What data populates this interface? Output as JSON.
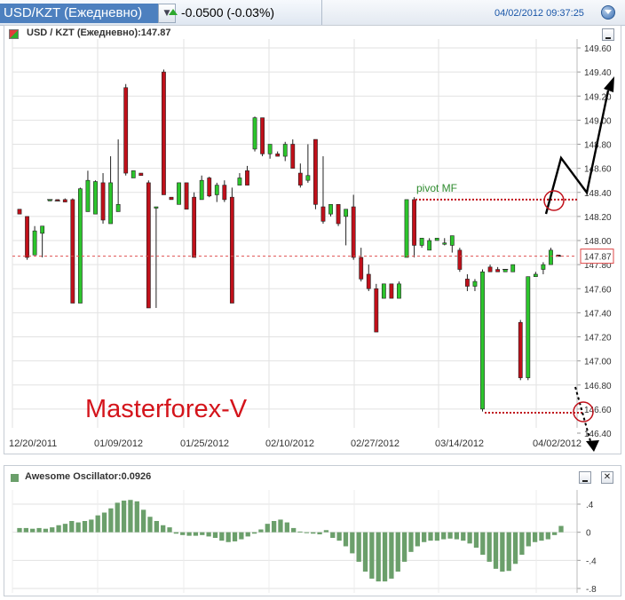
{
  "header": {
    "title": "USD/KZT (Ежедневно)",
    "change": "-0.0500 (-0.03%)",
    "datetime": "04/02/2012 09:37:25",
    "change_color": "#2da82d",
    "accent": "#4d80bf"
  },
  "main_panel": {
    "label": "USD / KZT (Ежедневно):147.87",
    "minimize_icon": "minimize-icon",
    "watermark": "Masterforex-V",
    "pivot_label": "pivot MF",
    "current_price_label": "147.87"
  },
  "osc_panel": {
    "label": "Awesome Oscillator:0.0926",
    "minimize_icon": "minimize-icon",
    "close_icon": "close-icon",
    "close_glyph": "✕"
  },
  "chart_data": [
    {
      "type": "candlestick",
      "title": "USD / KZT (Ежедневно):147.87",
      "y_ticks": [
        "149.60",
        "149.40",
        "149.20",
        "149.00",
        "148.80",
        "148.60",
        "148.40",
        "148.20",
        "148.00",
        "147.80",
        "147.60",
        "147.40",
        "147.20",
        "147.00",
        "146.80",
        "146.60",
        "146.40"
      ],
      "x_ticks": [
        "12/20/2011",
        "01/09/2012",
        "01/25/2012",
        "02/10/2012",
        "02/27/2012",
        "03/14/2012",
        "04/02/2012"
      ],
      "ylim": [
        146.33,
        149.7
      ],
      "current_price": 147.87,
      "pivot_level": 148.34,
      "support_level": 146.57,
      "pivot_label": "pivot MF",
      "up_color": "#2cc52c",
      "down_color": "#c0101a",
      "candles": [
        {
          "o": 148.26,
          "h": 148.26,
          "l": 148.22,
          "c": 148.22
        },
        {
          "o": 148.2,
          "h": 148.2,
          "l": 147.84,
          "c": 147.86
        },
        {
          "o": 147.88,
          "h": 148.12,
          "l": 147.88,
          "c": 148.08
        },
        {
          "o": 148.06,
          "h": 148.1,
          "l": 147.86,
          "c": 148.12
        },
        {
          "o": 148.34,
          "h": 148.34,
          "l": 148.34,
          "c": 148.34
        },
        {
          "o": 148.34,
          "h": 148.34,
          "l": 148.33,
          "c": 148.33
        },
        {
          "o": 148.34,
          "h": 148.35,
          "l": 148.32,
          "c": 148.32
        },
        {
          "o": 148.34,
          "h": 148.35,
          "l": 147.48,
          "c": 147.48
        },
        {
          "o": 147.48,
          "h": 148.44,
          "l": 147.48,
          "c": 148.43
        },
        {
          "o": 148.24,
          "h": 148.58,
          "l": 148.24,
          "c": 148.5
        },
        {
          "o": 148.22,
          "h": 148.5,
          "l": 148.22,
          "c": 148.49
        },
        {
          "o": 148.48,
          "h": 148.56,
          "l": 148.14,
          "c": 148.17
        },
        {
          "o": 148.14,
          "h": 148.7,
          "l": 148.14,
          "c": 148.48
        },
        {
          "o": 148.24,
          "h": 148.84,
          "l": 148.24,
          "c": 148.3
        },
        {
          "o": 149.27,
          "h": 149.3,
          "l": 148.54,
          "c": 148.56
        },
        {
          "o": 148.52,
          "h": 148.58,
          "l": 148.52,
          "c": 148.58
        },
        {
          "o": 148.56,
          "h": 148.56,
          "l": 148.54,
          "c": 148.54
        },
        {
          "o": 148.48,
          "h": 148.5,
          "l": 147.44,
          "c": 147.44
        },
        {
          "o": 148.28,
          "h": 148.28,
          "l": 147.44,
          "c": 148.28
        },
        {
          "o": 149.4,
          "h": 149.42,
          "l": 148.38,
          "c": 148.38
        },
        {
          "o": 148.36,
          "h": 148.36,
          "l": 148.34,
          "c": 148.34
        },
        {
          "o": 148.3,
          "h": 148.48,
          "l": 148.3,
          "c": 148.48
        },
        {
          "o": 148.48,
          "h": 148.48,
          "l": 148.26,
          "c": 148.26
        },
        {
          "o": 148.36,
          "h": 148.4,
          "l": 147.86,
          "c": 147.86
        },
        {
          "o": 148.34,
          "h": 148.54,
          "l": 148.34,
          "c": 148.5
        },
        {
          "o": 148.52,
          "h": 148.53,
          "l": 148.36,
          "c": 148.37
        },
        {
          "o": 148.38,
          "h": 148.48,
          "l": 148.32,
          "c": 148.46
        },
        {
          "o": 148.46,
          "h": 148.5,
          "l": 148.32,
          "c": 148.34
        },
        {
          "o": 148.36,
          "h": 148.44,
          "l": 147.48,
          "c": 147.48
        },
        {
          "o": 148.46,
          "h": 148.56,
          "l": 148.46,
          "c": 148.52
        },
        {
          "o": 148.58,
          "h": 148.62,
          "l": 148.46,
          "c": 148.46
        },
        {
          "o": 148.76,
          "h": 149.03,
          "l": 148.74,
          "c": 149.02
        },
        {
          "o": 149.02,
          "h": 149.02,
          "l": 148.7,
          "c": 148.72
        },
        {
          "o": 148.72,
          "h": 148.8,
          "l": 148.68,
          "c": 148.8
        },
        {
          "o": 148.72,
          "h": 148.74,
          "l": 148.7,
          "c": 148.7
        },
        {
          "o": 148.7,
          "h": 148.82,
          "l": 148.66,
          "c": 148.8
        },
        {
          "o": 148.8,
          "h": 148.84,
          "l": 148.6,
          "c": 148.6
        },
        {
          "o": 148.56,
          "h": 148.64,
          "l": 148.44,
          "c": 148.46
        },
        {
          "o": 148.5,
          "h": 148.8,
          "l": 148.48,
          "c": 148.54
        },
        {
          "o": 148.84,
          "h": 148.84,
          "l": 148.26,
          "c": 148.3
        },
        {
          "o": 148.28,
          "h": 148.7,
          "l": 148.14,
          "c": 148.16
        },
        {
          "o": 148.22,
          "h": 148.3,
          "l": 148.2,
          "c": 148.3
        },
        {
          "o": 148.3,
          "h": 148.3,
          "l": 148.12,
          "c": 148.14
        },
        {
          "o": 148.2,
          "h": 148.26,
          "l": 147.96,
          "c": 148.26
        },
        {
          "o": 148.28,
          "h": 148.38,
          "l": 147.84,
          "c": 147.86
        },
        {
          "o": 147.86,
          "h": 147.94,
          "l": 147.66,
          "c": 147.68
        },
        {
          "o": 147.72,
          "h": 147.8,
          "l": 147.58,
          "c": 147.6
        },
        {
          "o": 147.6,
          "h": 147.64,
          "l": 147.24,
          "c": 147.24
        },
        {
          "o": 147.52,
          "h": 147.64,
          "l": 147.52,
          "c": 147.64
        },
        {
          "o": 147.64,
          "h": 147.64,
          "l": 147.52,
          "c": 147.52
        },
        {
          "o": 147.52,
          "h": 147.66,
          "l": 147.52,
          "c": 147.64
        },
        {
          "o": 147.86,
          "h": 148.34,
          "l": 147.86,
          "c": 148.34
        },
        {
          "o": 148.34,
          "h": 148.36,
          "l": 147.86,
          "c": 147.96
        },
        {
          "o": 147.96,
          "h": 148.02,
          "l": 147.94,
          "c": 148.02
        },
        {
          "o": 147.92,
          "h": 148.02,
          "l": 147.92,
          "c": 148.0
        },
        {
          "o": 148.0,
          "h": 148.02,
          "l": 148.0,
          "c": 148.02
        },
        {
          "o": 147.98,
          "h": 148.02,
          "l": 147.96,
          "c": 147.98
        },
        {
          "o": 147.96,
          "h": 148.04,
          "l": 147.9,
          "c": 148.04
        },
        {
          "o": 147.92,
          "h": 147.94,
          "l": 147.74,
          "c": 147.76
        },
        {
          "o": 147.68,
          "h": 147.72,
          "l": 147.58,
          "c": 147.62
        },
        {
          "o": 147.62,
          "h": 147.68,
          "l": 147.58,
          "c": 147.66
        },
        {
          "o": 146.6,
          "h": 147.76,
          "l": 146.58,
          "c": 147.74
        },
        {
          "o": 147.78,
          "h": 147.8,
          "l": 147.74,
          "c": 147.74
        },
        {
          "o": 147.76,
          "h": 147.78,
          "l": 147.74,
          "c": 147.74
        },
        {
          "o": 147.74,
          "h": 147.76,
          "l": 147.74,
          "c": 147.76
        },
        {
          "o": 147.74,
          "h": 147.8,
          "l": 147.74,
          "c": 147.8
        },
        {
          "o": 147.32,
          "h": 147.34,
          "l": 146.84,
          "c": 146.86
        },
        {
          "o": 146.86,
          "h": 147.7,
          "l": 146.84,
          "c": 147.7
        },
        {
          "o": 147.7,
          "h": 147.74,
          "l": 147.7,
          "c": 147.72
        },
        {
          "o": 147.76,
          "h": 147.82,
          "l": 147.72,
          "c": 147.8
        },
        {
          "o": 147.8,
          "h": 147.94,
          "l": 147.8,
          "c": 147.92
        },
        {
          "o": 147.88,
          "h": 147.88,
          "l": 147.87,
          "c": 147.87
        }
      ]
    },
    {
      "type": "bar",
      "title": "Awesome Oscillator:0.0926",
      "y_ticks": [
        ".4",
        "0",
        "-.4",
        "-.8"
      ],
      "ylim": [
        -0.82,
        0.55
      ],
      "bar_color": "#6b9f6b",
      "values": [
        0.06,
        0.06,
        0.05,
        0.06,
        0.05,
        0.07,
        0.1,
        0.12,
        0.16,
        0.14,
        0.16,
        0.18,
        0.24,
        0.28,
        0.34,
        0.42,
        0.45,
        0.46,
        0.44,
        0.32,
        0.22,
        0.16,
        0.1,
        0.07,
        -0.02,
        -0.04,
        -0.05,
        -0.05,
        -0.04,
        -0.06,
        -0.08,
        -0.12,
        -0.14,
        -0.13,
        -0.1,
        -0.06,
        -0.02,
        0.04,
        0.12,
        0.16,
        0.18,
        0.14,
        0.06,
        0.01,
        -0.01,
        -0.02,
        -0.03,
        0.03,
        -0.08,
        -0.12,
        -0.2,
        -0.3,
        -0.42,
        -0.56,
        -0.66,
        -0.7,
        -0.7,
        -0.66,
        -0.56,
        -0.42,
        -0.28,
        -0.2,
        -0.14,
        -0.12,
        -0.12,
        -0.1,
        -0.09,
        -0.1,
        -0.12,
        -0.16,
        -0.22,
        -0.32,
        -0.42,
        -0.52,
        -0.56,
        -0.55,
        -0.45,
        -0.32,
        -0.2,
        -0.14,
        -0.12,
        -0.1,
        -0.04,
        0.09
      ]
    }
  ]
}
